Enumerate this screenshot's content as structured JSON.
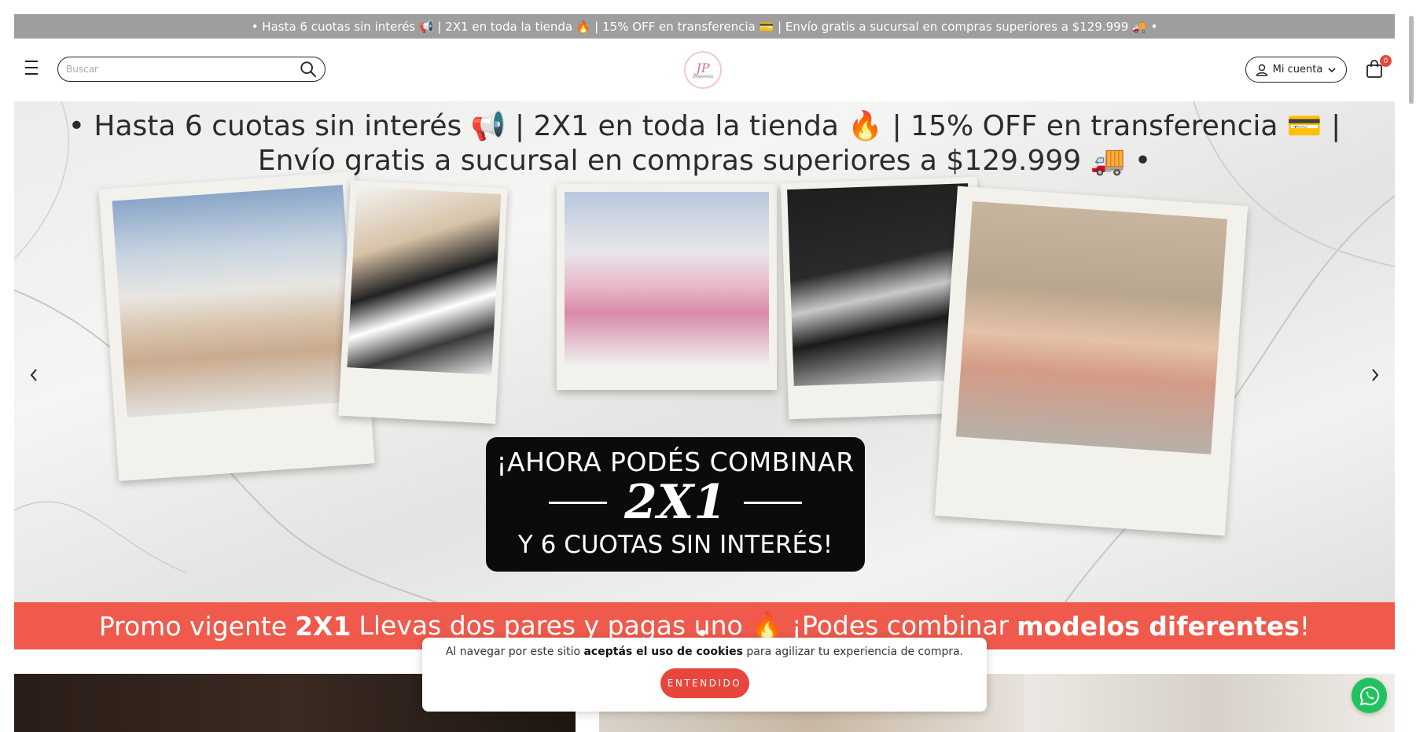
{
  "announcement": {
    "text": "• Hasta 6 cuotas sin interés 📢 | 2X1 en toda la tienda 🔥 | 15% OFF en transferencia 💳 | Envío gratis a sucursal en compras superiores a $129.999 🚚 •"
  },
  "header": {
    "menu_icon": "hamburger-menu-icon",
    "search": {
      "placeholder": "Buscar",
      "value": "",
      "icon": "search-icon"
    },
    "logo": {
      "monogram": "JP",
      "subtitle": "JUANAPARDO"
    },
    "account": {
      "label": "Mi cuenta",
      "icon": "user-icon",
      "chevron": "chevron-down-icon"
    },
    "cart": {
      "icon": "shopping-bag-icon",
      "count": "0"
    }
  },
  "hero": {
    "banner_line1": "• Hasta 6 cuotas sin interés 📢 | 2X1 en toda la tienda 🔥 | 15% OFF en transferencia 💳 |",
    "banner_line2": "Envío gratis a sucursal en compras superiores a $129.999 🚚 •",
    "promo_line1": "¡AHORA PODÉS COMBINAR",
    "promo_line2": "2X1",
    "promo_line3": "Y 6 CUOTAS SIN INTERÉS!",
    "footer_a": "Promo vigente",
    "footer_b": "2X1",
    "footer_c": "Llevas dos pares y pagas uno 🔥 ¡Podes combinar",
    "footer_d": "modelos diferentes",
    "footer_e": "!",
    "prev_icon": "chevron-left-icon",
    "next_icon": "chevron-right-icon"
  },
  "cookie_notice": {
    "text_before": "Al navegar por este sitio",
    "text_bold": "aceptás el uso de cookies",
    "text_after": "para agilizar tu experiencia de compra.",
    "button": "ENTENDIDO"
  },
  "whatsapp": {
    "icon": "whatsapp-icon"
  },
  "colors": {
    "accent": "#e8463c",
    "announce_bg": "#9e9e9e",
    "promo_bar": "#ef5a4c",
    "whatsapp": "#22c35e"
  }
}
